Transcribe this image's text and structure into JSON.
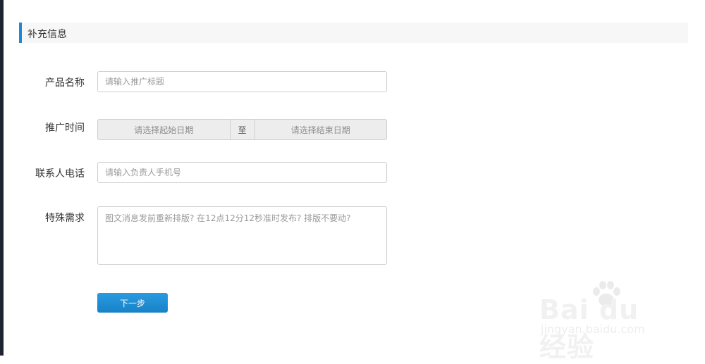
{
  "section": {
    "title": "补充信息"
  },
  "form": {
    "product_name": {
      "label": "产品名称",
      "placeholder": "请输入推广标题"
    },
    "promo_time": {
      "label": "推广时间",
      "start_placeholder": "请选择起始日期",
      "separator": "至",
      "end_placeholder": "请选择结束日期"
    },
    "contact_phone": {
      "label": "联系人电话",
      "placeholder": "请输入负责人手机号"
    },
    "special_request": {
      "label": "特殊需求",
      "placeholder": "图文消息发前重新排版? 在12点12分12秒准时发布? 排版不要动?"
    },
    "next_button": "下一步"
  },
  "watermark": {
    "logo": "Bai du 经验",
    "url": "jingyan.baidu.com"
  },
  "colors": {
    "accent": "#1b8ad3",
    "button": "#1782c8",
    "rail": "#1f2530"
  }
}
